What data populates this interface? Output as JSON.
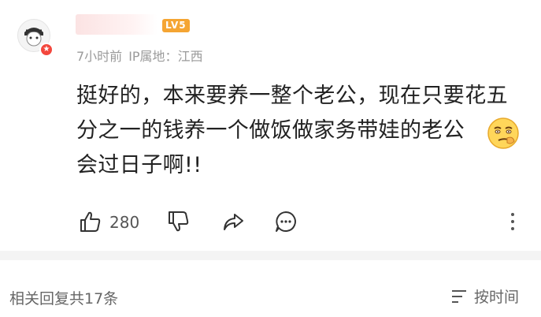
{
  "user": {
    "level_badge": "LV5",
    "time": "7小时前",
    "ip_label": "IP属地：",
    "ip_location": "江西"
  },
  "comment": {
    "lines": [
      "挺好的，本来要养一整个老公，现在只要花五",
      "分之一的钱养一个做饭做家务带娃的老公",
      "会过日子啊!!"
    ]
  },
  "actions": {
    "like_count": "280"
  },
  "footer": {
    "reply_count": "相关回复共17条",
    "sort_label": "按时间"
  },
  "colors": {
    "badge": "#f5a533",
    "meta_text": "#9a9a9a",
    "divider": "#f4f4f4"
  }
}
